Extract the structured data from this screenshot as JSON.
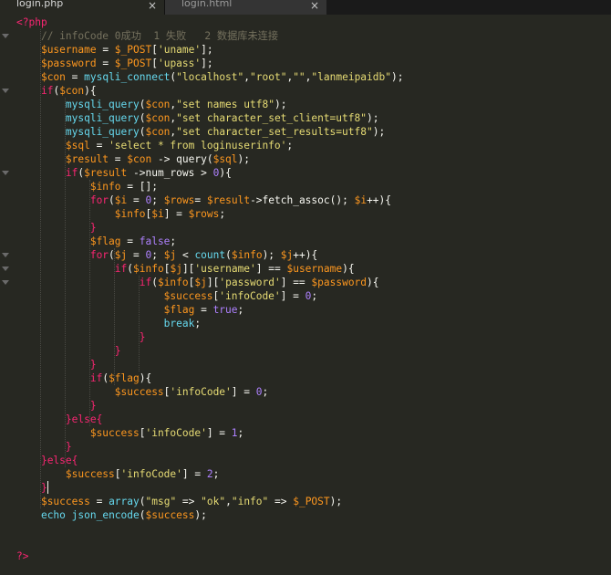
{
  "tabs": [
    {
      "label": "login.php",
      "close_icon": "×",
      "active": true
    },
    {
      "label": "login.html",
      "close_icon": "×",
      "active": false
    }
  ],
  "colors": {
    "background": "#272822",
    "plain": "#f8f8f2",
    "tag": "#f92672",
    "comment": "#75715e",
    "variable": "#fd971f",
    "string": "#e6db74",
    "number": "#ae81ff",
    "function": "#66d9ef"
  },
  "code_lines": [
    [
      [
        "t",
        "<?php"
      ]
    ],
    [
      [
        "w",
        "    "
      ],
      [
        "c",
        "// infoCode 0成功  1 失败   2 数据库未连接"
      ]
    ],
    [
      [
        "w",
        "    "
      ],
      [
        "v",
        "$username"
      ],
      [
        "p",
        " = "
      ],
      [
        "v",
        "$_POST"
      ],
      [
        "p",
        "["
      ],
      [
        "s",
        "'uname'"
      ],
      [
        "p",
        "];"
      ]
    ],
    [
      [
        "w",
        "    "
      ],
      [
        "v",
        "$password"
      ],
      [
        "p",
        " = "
      ],
      [
        "v",
        "$_POST"
      ],
      [
        "p",
        "["
      ],
      [
        "s",
        "'upass'"
      ],
      [
        "p",
        "];"
      ]
    ],
    [
      [
        "w",
        "    "
      ],
      [
        "v",
        "$con"
      ],
      [
        "p",
        " = "
      ],
      [
        "f",
        "mysqli_connect"
      ],
      [
        "p",
        "("
      ],
      [
        "s",
        "\"localhost\""
      ],
      [
        "p",
        ","
      ],
      [
        "s",
        "\"root\""
      ],
      [
        "p",
        ","
      ],
      [
        "s",
        "\"\""
      ],
      [
        "p",
        ","
      ],
      [
        "s",
        "\"lanmeipaidb\""
      ],
      [
        "p",
        ");"
      ]
    ],
    [
      [
        "w",
        "    "
      ],
      [
        "t",
        "if"
      ],
      [
        "p",
        "("
      ],
      [
        "v",
        "$con"
      ],
      [
        "p",
        "){"
      ]
    ],
    [
      [
        "w",
        "        "
      ],
      [
        "f",
        "mysqli_query"
      ],
      [
        "p",
        "("
      ],
      [
        "v",
        "$con"
      ],
      [
        "p",
        ","
      ],
      [
        "s",
        "\"set names utf8\""
      ],
      [
        "p",
        ");"
      ]
    ],
    [
      [
        "w",
        "        "
      ],
      [
        "f",
        "mysqli_query"
      ],
      [
        "p",
        "("
      ],
      [
        "v",
        "$con"
      ],
      [
        "p",
        ","
      ],
      [
        "s",
        "\"set character_set_client=utf8\""
      ],
      [
        "p",
        ");"
      ]
    ],
    [
      [
        "w",
        "        "
      ],
      [
        "f",
        "mysqli_query"
      ],
      [
        "p",
        "("
      ],
      [
        "v",
        "$con"
      ],
      [
        "p",
        ","
      ],
      [
        "s",
        "\"set character_set_results=utf8\""
      ],
      [
        "p",
        ");"
      ]
    ],
    [
      [
        "w",
        "        "
      ],
      [
        "v",
        "$sql"
      ],
      [
        "p",
        " = "
      ],
      [
        "s",
        "'select * from loginuserinfo'"
      ],
      [
        "p",
        ";"
      ]
    ],
    [
      [
        "w",
        "        "
      ],
      [
        "v",
        "$result"
      ],
      [
        "p",
        " = "
      ],
      [
        "v",
        "$con"
      ],
      [
        "p",
        " -> query("
      ],
      [
        "v",
        "$sql"
      ],
      [
        "p",
        ");"
      ]
    ],
    [
      [
        "w",
        "        "
      ],
      [
        "t",
        "if"
      ],
      [
        "p",
        "("
      ],
      [
        "v",
        "$result"
      ],
      [
        "p",
        " ->num_rows > "
      ],
      [
        "n",
        "0"
      ],
      [
        "p",
        "){"
      ]
    ],
    [
      [
        "w",
        "            "
      ],
      [
        "v",
        "$info"
      ],
      [
        "p",
        " = [];"
      ]
    ],
    [
      [
        "w",
        "            "
      ],
      [
        "t",
        "for"
      ],
      [
        "p",
        "("
      ],
      [
        "v",
        "$i"
      ],
      [
        "p",
        " = "
      ],
      [
        "n",
        "0"
      ],
      [
        "p",
        "; "
      ],
      [
        "v",
        "$rows"
      ],
      [
        "p",
        "= "
      ],
      [
        "v",
        "$result"
      ],
      [
        "p",
        "->fetch_assoc(); "
      ],
      [
        "v",
        "$i"
      ],
      [
        "p",
        "++){"
      ]
    ],
    [
      [
        "w",
        "                "
      ],
      [
        "v",
        "$info"
      ],
      [
        "p",
        "["
      ],
      [
        "v",
        "$i"
      ],
      [
        "p",
        "] = "
      ],
      [
        "v",
        "$rows"
      ],
      [
        "p",
        ";"
      ]
    ],
    [
      [
        "w",
        "            "
      ],
      [
        "t",
        "}"
      ]
    ],
    [
      [
        "w",
        "            "
      ],
      [
        "v",
        "$flag"
      ],
      [
        "p",
        " = "
      ],
      [
        "n",
        "false"
      ],
      [
        "p",
        ";"
      ]
    ],
    [
      [
        "w",
        "            "
      ],
      [
        "t",
        "for"
      ],
      [
        "p",
        "("
      ],
      [
        "v",
        "$j"
      ],
      [
        "p",
        " = "
      ],
      [
        "n",
        "0"
      ],
      [
        "p",
        "; "
      ],
      [
        "v",
        "$j"
      ],
      [
        "p",
        " < "
      ],
      [
        "f",
        "count"
      ],
      [
        "p",
        "("
      ],
      [
        "v",
        "$info"
      ],
      [
        "p",
        "); "
      ],
      [
        "v",
        "$j"
      ],
      [
        "p",
        "++){"
      ]
    ],
    [
      [
        "w",
        "                "
      ],
      [
        "t",
        "if"
      ],
      [
        "p",
        "("
      ],
      [
        "v",
        "$info"
      ],
      [
        "p",
        "["
      ],
      [
        "v",
        "$j"
      ],
      [
        "p",
        "]["
      ],
      [
        "s",
        "'username'"
      ],
      [
        "p",
        "] == "
      ],
      [
        "v",
        "$username"
      ],
      [
        "p",
        "){"
      ]
    ],
    [
      [
        "w",
        "                    "
      ],
      [
        "t",
        "if"
      ],
      [
        "p",
        "("
      ],
      [
        "v",
        "$info"
      ],
      [
        "p",
        "["
      ],
      [
        "v",
        "$j"
      ],
      [
        "p",
        "]["
      ],
      [
        "s",
        "'password'"
      ],
      [
        "p",
        "] == "
      ],
      [
        "v",
        "$password"
      ],
      [
        "p",
        "){"
      ]
    ],
    [
      [
        "w",
        "                        "
      ],
      [
        "v",
        "$success"
      ],
      [
        "p",
        "["
      ],
      [
        "s",
        "'infoCode'"
      ],
      [
        "p",
        "] = "
      ],
      [
        "n",
        "0"
      ],
      [
        "p",
        ";"
      ]
    ],
    [
      [
        "w",
        "                        "
      ],
      [
        "v",
        "$flag"
      ],
      [
        "p",
        " = "
      ],
      [
        "n",
        "true"
      ],
      [
        "p",
        ";"
      ]
    ],
    [
      [
        "w",
        "                        "
      ],
      [
        "f",
        "break"
      ],
      [
        "p",
        ";"
      ]
    ],
    [
      [
        "w",
        "                    "
      ],
      [
        "t",
        "}"
      ]
    ],
    [
      [
        "w",
        "                "
      ],
      [
        "t",
        "}"
      ]
    ],
    [
      [
        "w",
        "            "
      ],
      [
        "t",
        "}"
      ]
    ],
    [
      [
        "w",
        "            "
      ],
      [
        "t",
        "if"
      ],
      [
        "p",
        "("
      ],
      [
        "v",
        "$flag"
      ],
      [
        "p",
        "){"
      ]
    ],
    [
      [
        "w",
        "                "
      ],
      [
        "v",
        "$success"
      ],
      [
        "p",
        "["
      ],
      [
        "s",
        "'infoCode'"
      ],
      [
        "p",
        "] = "
      ],
      [
        "n",
        "0"
      ],
      [
        "p",
        ";"
      ]
    ],
    [
      [
        "w",
        "            "
      ],
      [
        "t",
        "}"
      ]
    ],
    [
      [
        "w",
        "        "
      ],
      [
        "t",
        "}else{"
      ]
    ],
    [
      [
        "w",
        "            "
      ],
      [
        "v",
        "$success"
      ],
      [
        "p",
        "["
      ],
      [
        "s",
        "'infoCode'"
      ],
      [
        "p",
        "] = "
      ],
      [
        "n",
        "1"
      ],
      [
        "p",
        ";"
      ]
    ],
    [
      [
        "w",
        "        "
      ],
      [
        "t",
        "}"
      ]
    ],
    [
      [
        "w",
        "    "
      ],
      [
        "t",
        "}else{"
      ]
    ],
    [
      [
        "w",
        "        "
      ],
      [
        "v",
        "$success"
      ],
      [
        "p",
        "["
      ],
      [
        "s",
        "'infoCode'"
      ],
      [
        "p",
        "] = "
      ],
      [
        "n",
        "2"
      ],
      [
        "p",
        ";"
      ]
    ],
    [
      [
        "w",
        "    "
      ],
      [
        "t",
        "}"
      ]
    ],
    [
      [
        "w",
        "    "
      ],
      [
        "v",
        "$success"
      ],
      [
        "p",
        " = "
      ],
      [
        "f",
        "array"
      ],
      [
        "p",
        "("
      ],
      [
        "s",
        "\"msg\""
      ],
      [
        "p",
        " => "
      ],
      [
        "s",
        "\"ok\""
      ],
      [
        "p",
        ","
      ],
      [
        "s",
        "\"info\""
      ],
      [
        "p",
        " => "
      ],
      [
        "v",
        "$_POST"
      ],
      [
        "p",
        ");"
      ]
    ],
    [
      [
        "w",
        "    "
      ],
      [
        "f",
        "echo"
      ],
      [
        "p",
        " "
      ],
      [
        "f",
        "json_encode"
      ],
      [
        "p",
        "("
      ],
      [
        "v",
        "$success"
      ],
      [
        "p",
        ");"
      ]
    ],
    [
      [
        "w",
        ""
      ]
    ],
    [
      [
        "w",
        ""
      ]
    ],
    [
      [
        "t",
        "?>"
      ]
    ]
  ]
}
